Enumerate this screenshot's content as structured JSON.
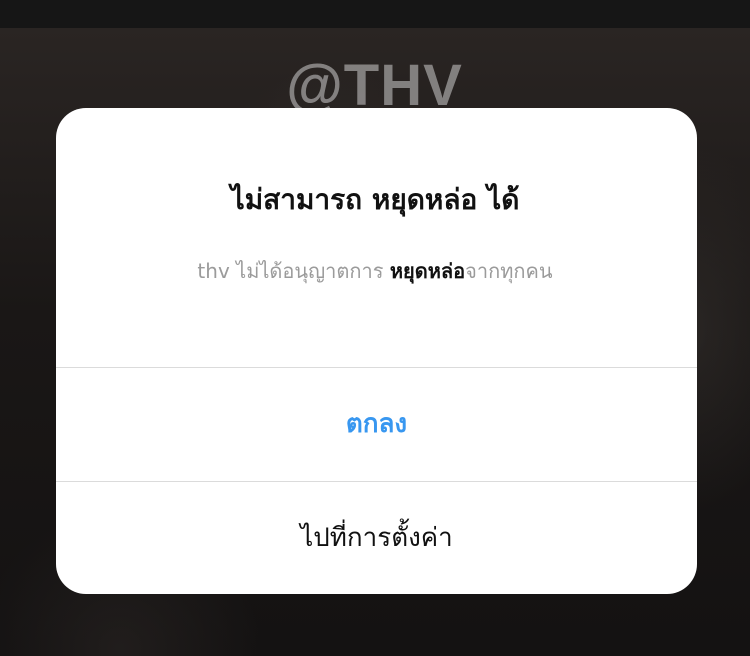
{
  "background": {
    "watermark": "@THV"
  },
  "alert": {
    "title": "ไม่สามารถ หยุดหล่อ ได้",
    "message_prefix": "thv ไม่ได้อนุญาตการ ",
    "message_bold": "หยุดหล่อ",
    "message_suffix": "จากทุกคน",
    "primary_action": "ตกลง",
    "secondary_action": "ไปที่การตั้งค่า"
  },
  "colors": {
    "accent": "#3897f0",
    "title_text": "#111111",
    "message_text": "#9b9b9b",
    "divider": "#dbdbdb"
  }
}
